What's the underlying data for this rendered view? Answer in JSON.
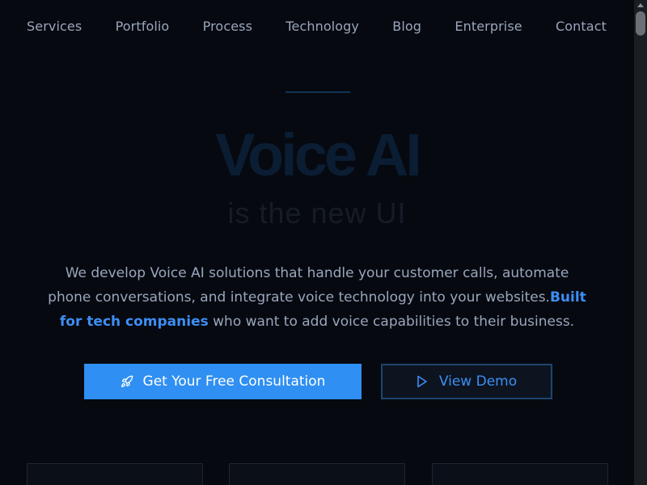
{
  "nav": {
    "items": [
      {
        "label": "Services"
      },
      {
        "label": "Portfolio"
      },
      {
        "label": "Process"
      },
      {
        "label": "Technology"
      },
      {
        "label": "Blog"
      },
      {
        "label": "Enterprise"
      },
      {
        "label": "Contact"
      }
    ]
  },
  "hero": {
    "title": "Voice AI",
    "subtitle": "is the new UI",
    "description_start": "We develop Voice AI solutions that handle your customer calls, automate phone conversations, and integrate voice technology into your websites.",
    "description_highlight": "Built for tech companies",
    "description_end": " who want to add voice capabilities to their business."
  },
  "buttons": {
    "primary_label": "Get Your Free Consultation",
    "primary_icon": "rocket-icon",
    "secondary_label": "View Demo",
    "secondary_icon": "play-icon"
  },
  "colors": {
    "background": "#060910",
    "accent": "#2f8ff2",
    "nav_text": "#9aa6bc"
  }
}
